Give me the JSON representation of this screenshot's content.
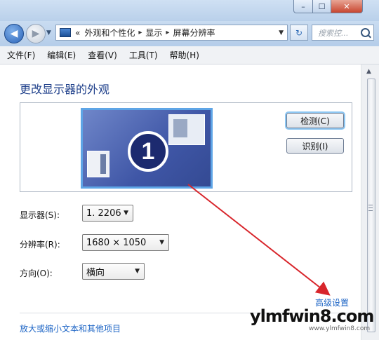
{
  "window": {
    "min_label": "–",
    "max_label": "☐",
    "close_label": "✕"
  },
  "address": {
    "chevron": "«",
    "crumbs": [
      "外观和个性化",
      "显示",
      "屏幕分辨率"
    ],
    "separator": "▸",
    "search_placeholder": "搜索控..."
  },
  "menu": [
    "文件(F)",
    "编辑(E)",
    "查看(V)",
    "工具(T)",
    "帮助(H)"
  ],
  "page": {
    "heading": "更改显示器的外观",
    "monitor_number": "1",
    "detect_button": "检测(C)",
    "identify_button": "识别(I)",
    "display_label": "显示器(S):",
    "display_value": "1. 2206",
    "resolution_label": "分辨率(R):",
    "resolution_value": "1680 × 1050",
    "orientation_label": "方向(O):",
    "orientation_value": "横向",
    "advanced_link": "高级设置",
    "bottom_link": "放大或缩小文本和其他项目"
  },
  "watermark": {
    "main": "ylmfwin8.com",
    "sub": "www.ylmfwin8.com"
  },
  "colors": {
    "link": "#1c64c5",
    "heading": "#1e3f8a",
    "arrow": "#d8252b"
  }
}
